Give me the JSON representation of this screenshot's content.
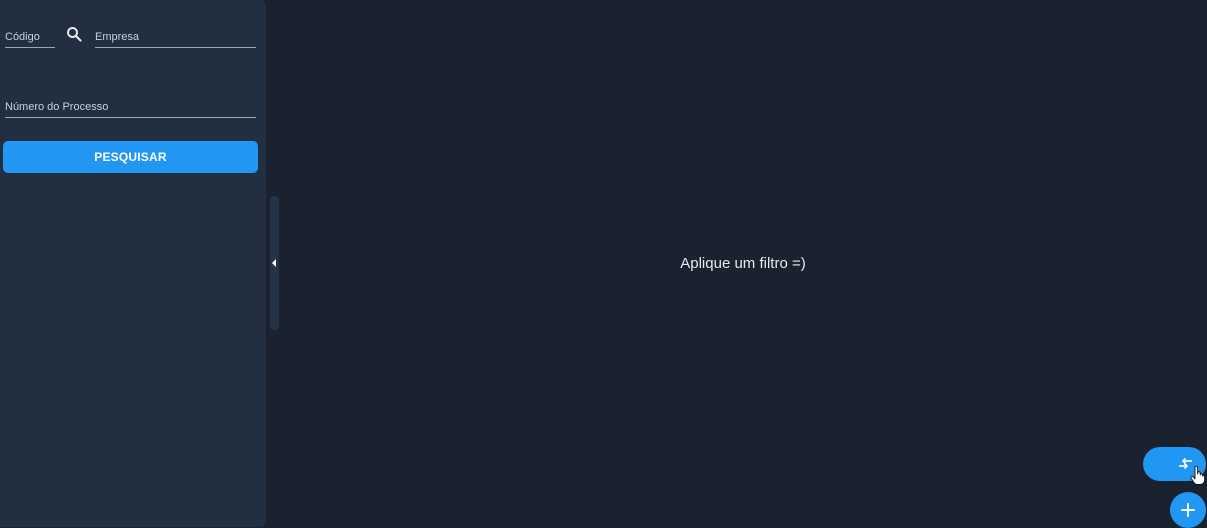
{
  "filters": {
    "codigo": {
      "placeholder": "Código",
      "value": ""
    },
    "empresa": {
      "placeholder": "Empresa",
      "value": ""
    },
    "processo": {
      "placeholder": "Número do Processo",
      "value": ""
    },
    "search_button_label": "PESQUISAR"
  },
  "main": {
    "empty_message": "Aplique um filtro =)"
  },
  "icons": {
    "search": "search-icon",
    "collapse": "chevron-left-icon",
    "swap": "swap-arrows-icon",
    "add": "plus-icon",
    "cursor": "hand-pointer-icon"
  },
  "colors": {
    "background": "#1b222f",
    "sidebar": "#212f40",
    "accent": "#2196f3",
    "text": "#e6e9ee"
  }
}
